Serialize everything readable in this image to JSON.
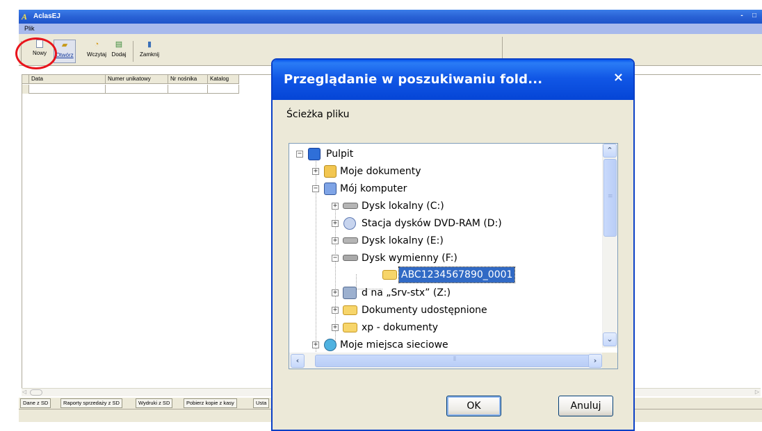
{
  "app": {
    "title": "AclasEJ",
    "menu": [
      "Plik"
    ],
    "window_controls": [
      "-",
      "□",
      "×"
    ],
    "toolbar": [
      {
        "label": "Nowy",
        "icon": "new-file-icon"
      },
      {
        "label": "Otwórz",
        "icon": "open-folder-icon"
      },
      {
        "label": "Wczytaj",
        "icon": "load-icon"
      },
      {
        "label": "Dodaj",
        "icon": "add-icon"
      },
      {
        "label": "Zamknij",
        "icon": "close-door-icon"
      }
    ],
    "grid": {
      "columns": [
        "Data",
        "Numer unikatowy",
        "Nr nośnika",
        "Katalog"
      ]
    },
    "tabs": [
      "Dane z SD",
      "Raporty sprzedaży z SD",
      "Wydruki z SD",
      "Pobierz kopie z kasy",
      "Usta"
    ]
  },
  "dialog": {
    "title": "Przeglądanie w poszukiwaniu fold...",
    "close_glyph": "×",
    "prompt": "Ścieżka pliku",
    "tree": [
      {
        "label": "Pulpit",
        "expander": "−",
        "icon": "desktop-icon"
      },
      {
        "label": "Moje dokumenty",
        "expander": "+",
        "icon": "my-documents-icon"
      },
      {
        "label": "Mój komputer",
        "expander": "−",
        "icon": "my-computer-icon"
      },
      {
        "label": "Dysk lokalny (C:)",
        "expander": "+",
        "icon": "hard-drive-icon"
      },
      {
        "label": "Stacja dysków DVD-RAM (D:)",
        "expander": "+",
        "icon": "dvd-drive-icon"
      },
      {
        "label": "Dysk lokalny (E:)",
        "expander": "+",
        "icon": "hard-drive-icon"
      },
      {
        "label": "Dysk wymienny (F:)",
        "expander": "−",
        "icon": "removable-drive-icon"
      },
      {
        "label": "ABC1234567890_0001",
        "expander": "",
        "icon": "open-folder-icon",
        "selected": true
      },
      {
        "label": "d na „Srv-stx” (Z:)",
        "expander": "+",
        "icon": "network-drive-icon"
      },
      {
        "label": "Dokumenty udostępnione",
        "expander": "+",
        "icon": "folder-icon"
      },
      {
        "label": "xp - dokumenty",
        "expander": "+",
        "icon": "folder-icon"
      },
      {
        "label": "Moje miejsca sieciowe",
        "expander": "+",
        "icon": "network-places-icon"
      }
    ],
    "ok_label": "OK",
    "cancel_label": "Anuluj"
  },
  "colors": {
    "titlebar": "#2a62d6",
    "dialog_title": "#0545d6",
    "selection": "#316ac5",
    "highlight_circle": "#e8141c",
    "face": "#ece9d8"
  }
}
